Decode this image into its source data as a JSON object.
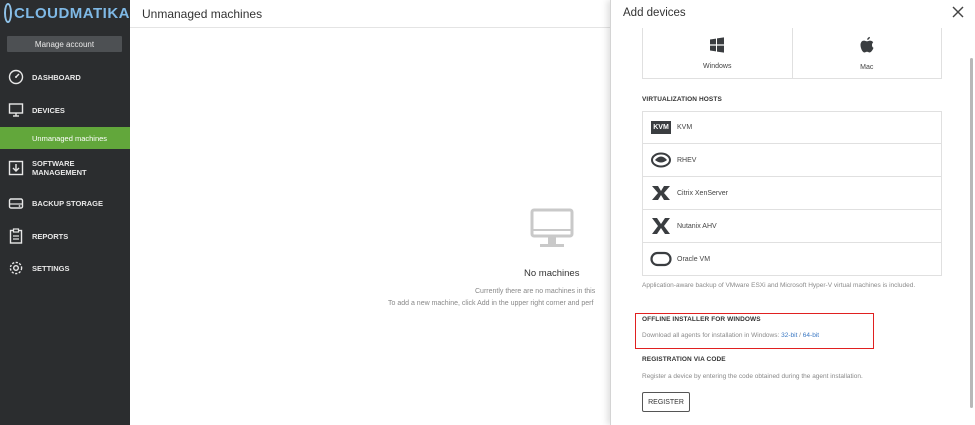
{
  "brand": {
    "name": "CLOUDMATIKA"
  },
  "sidebar": {
    "manage_account": "Manage account",
    "items": [
      {
        "label": "DASHBOARD",
        "icon": "dashboard-icon"
      },
      {
        "label": "DEVICES",
        "icon": "monitor-icon"
      },
      {
        "label": "SOFTWARE MANAGEMENT",
        "icon": "download-box-icon"
      },
      {
        "label": "BACKUP STORAGE",
        "icon": "hard-drive-icon"
      },
      {
        "label": "REPORTS",
        "icon": "clipboard-icon"
      },
      {
        "label": "SETTINGS",
        "icon": "gear-icon"
      }
    ],
    "sub_item": "Unmanaged machines",
    "accent_color": "#62a73b"
  },
  "main": {
    "title": "Unmanaged machines",
    "empty_title": "No machines",
    "empty_line1": "Currently there are no machines in this",
    "empty_line2": "To add a new machine, click Add in the upper right corner and perf"
  },
  "panel": {
    "title": "Add devices",
    "os": [
      {
        "label": "Windows",
        "icon": "windows-icon"
      },
      {
        "label": "Mac",
        "icon": "apple-icon"
      }
    ],
    "virtualization_heading": "VIRTUALIZATION HOSTS",
    "hosts": [
      {
        "label": "KVM",
        "icon": "kvm-icon",
        "badge": "KVM"
      },
      {
        "label": "RHEV",
        "icon": "rhev-icon"
      },
      {
        "label": "Citrix XenServer",
        "icon": "xen-icon"
      },
      {
        "label": "Nutanix AHV",
        "icon": "nutanix-icon"
      },
      {
        "label": "Oracle VM",
        "icon": "oracle-icon"
      }
    ],
    "virt_note": "Application-aware backup of VMware ESXi and Microsoft Hyper-V virtual machines is included.",
    "offline_heading": "OFFLINE INSTALLER FOR WINDOWS",
    "offline_text": "Download all agents for installation in Windows:",
    "link_32": "32-bit",
    "link_sep": " / ",
    "link_64": "64-bit",
    "registration_heading": "REGISTRATION VIA CODE",
    "registration_text": "Register a device by entering the code obtained during the agent installation.",
    "register_button": "REGISTER"
  }
}
